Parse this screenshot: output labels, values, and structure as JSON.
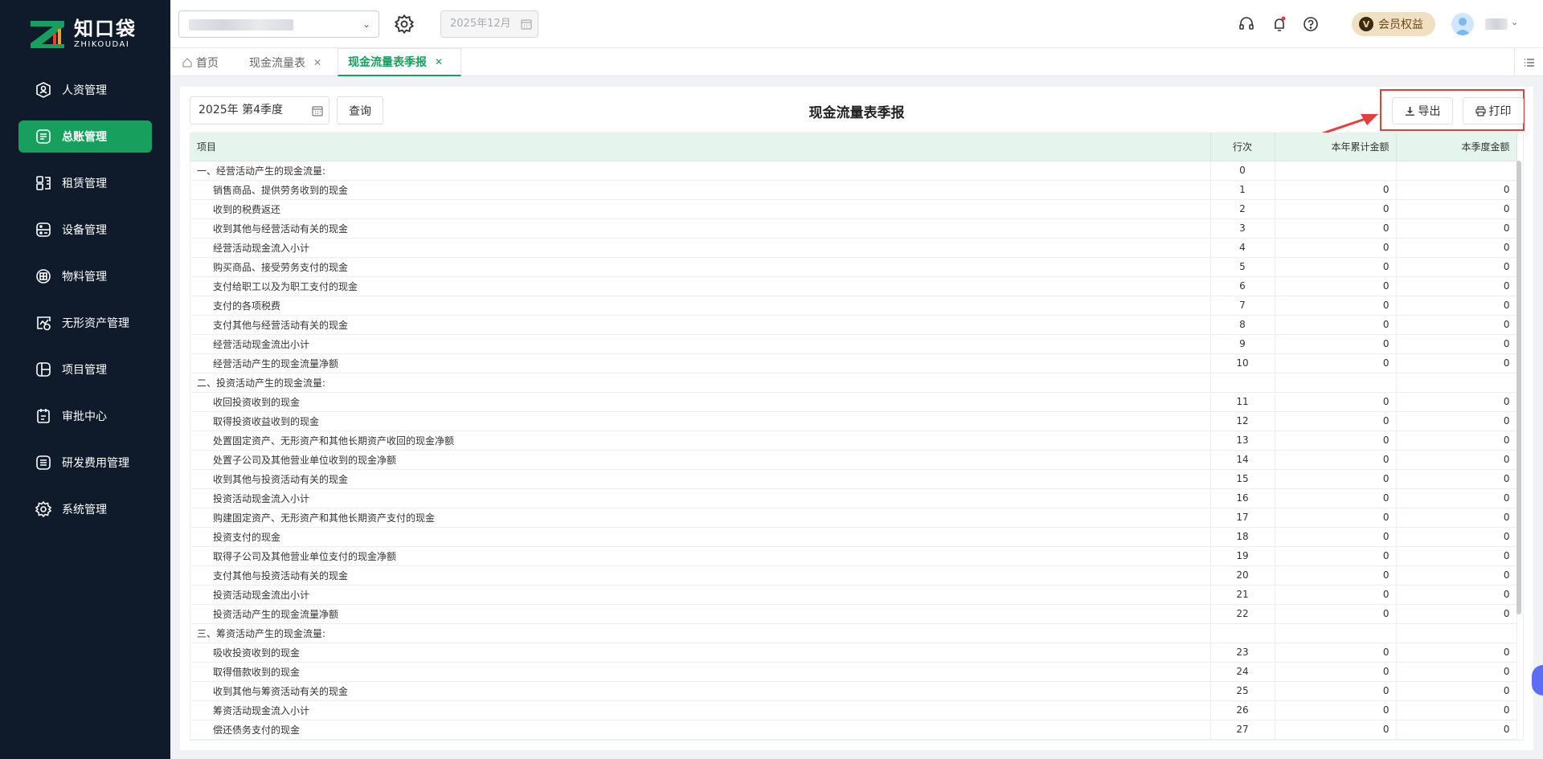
{
  "brand": {
    "name_cn": "知口袋",
    "name_en": "ZHIKOUDAI"
  },
  "sidebar": {
    "items": [
      {
        "label": "人资管理",
        "icon": "person-icon",
        "active": false
      },
      {
        "label": "总账管理",
        "icon": "ledger-icon",
        "active": true
      },
      {
        "label": "租赁管理",
        "icon": "lease-icon",
        "active": false
      },
      {
        "label": "设备管理",
        "icon": "device-icon",
        "active": false
      },
      {
        "label": "物料管理",
        "icon": "material-icon",
        "active": false
      },
      {
        "label": "无形资产管理",
        "icon": "intangible-asset-icon",
        "active": false
      },
      {
        "label": "项目管理",
        "icon": "project-icon",
        "active": false
      },
      {
        "label": "审批中心",
        "icon": "approval-icon",
        "active": false
      },
      {
        "label": "研发费用管理",
        "icon": "rd-expense-icon",
        "active": false
      },
      {
        "label": "系统管理",
        "icon": "gear-icon",
        "active": false
      }
    ]
  },
  "header": {
    "period": "2025年12月",
    "vip_label": "会员权益",
    "vip_badge": "V"
  },
  "tabs": [
    {
      "label": "首页",
      "closable": false,
      "active": false
    },
    {
      "label": "现金流量表",
      "closable": true,
      "active": false
    },
    {
      "label": "现金流量表季报",
      "closable": true,
      "active": true
    }
  ],
  "toolbar": {
    "period_value": "2025年 第4季度",
    "query_label": "查询",
    "title": "现金流量表季报",
    "export_label": "导出",
    "print_label": "打印"
  },
  "table": {
    "headers": [
      "项目",
      "行次",
      "本年累计金额",
      "本季度金额"
    ],
    "rows": [
      {
        "item": "一、经营活动产生的现金流量:",
        "line": "0",
        "ytd": "",
        "qtr": "",
        "section": true
      },
      {
        "item": "销售商品、提供劳务收到的现金",
        "line": "1",
        "ytd": "0",
        "qtr": "0"
      },
      {
        "item": "收到的税费返还",
        "line": "2",
        "ytd": "0",
        "qtr": "0"
      },
      {
        "item": "收到其他与经营活动有关的现金",
        "line": "3",
        "ytd": "0",
        "qtr": "0"
      },
      {
        "item": "经营活动现金流入小计",
        "line": "4",
        "ytd": "0",
        "qtr": "0"
      },
      {
        "item": "购买商品、接受劳务支付的现金",
        "line": "5",
        "ytd": "0",
        "qtr": "0"
      },
      {
        "item": "支付给职工以及为职工支付的现金",
        "line": "6",
        "ytd": "0",
        "qtr": "0"
      },
      {
        "item": "支付的各项税费",
        "line": "7",
        "ytd": "0",
        "qtr": "0"
      },
      {
        "item": "支付其他与经营活动有关的现金",
        "line": "8",
        "ytd": "0",
        "qtr": "0"
      },
      {
        "item": "经营活动现金流出小计",
        "line": "9",
        "ytd": "0",
        "qtr": "0"
      },
      {
        "item": "经营活动产生的现金流量净额",
        "line": "10",
        "ytd": "0",
        "qtr": "0"
      },
      {
        "item": "二、投资活动产生的现金流量:",
        "line": "",
        "ytd": "",
        "qtr": "",
        "section": true
      },
      {
        "item": "收回投资收到的现金",
        "line": "11",
        "ytd": "0",
        "qtr": "0"
      },
      {
        "item": "取得投资收益收到的现金",
        "line": "12",
        "ytd": "0",
        "qtr": "0"
      },
      {
        "item": "处置固定资产、无形资产和其他长期资产收回的现金净额",
        "line": "13",
        "ytd": "0",
        "qtr": "0"
      },
      {
        "item": "处置子公司及其他营业单位收到的现金净额",
        "line": "14",
        "ytd": "0",
        "qtr": "0"
      },
      {
        "item": "收到其他与投资活动有关的现金",
        "line": "15",
        "ytd": "0",
        "qtr": "0"
      },
      {
        "item": "投资活动现金流入小计",
        "line": "16",
        "ytd": "0",
        "qtr": "0"
      },
      {
        "item": "购建固定资产、无形资产和其他长期资产支付的现金",
        "line": "17",
        "ytd": "0",
        "qtr": "0"
      },
      {
        "item": "投资支付的现金",
        "line": "18",
        "ytd": "0",
        "qtr": "0"
      },
      {
        "item": "取得子公司及其他营业单位支付的现金净额",
        "line": "19",
        "ytd": "0",
        "qtr": "0"
      },
      {
        "item": "支付其他与投资活动有关的现金",
        "line": "20",
        "ytd": "0",
        "qtr": "0"
      },
      {
        "item": "投资活动现金流出小计",
        "line": "21",
        "ytd": "0",
        "qtr": "0"
      },
      {
        "item": "投资活动产生的现金流量净额",
        "line": "22",
        "ytd": "0",
        "qtr": "0"
      },
      {
        "item": "三、筹资活动产生的现金流量:",
        "line": "",
        "ytd": "",
        "qtr": "",
        "section": true
      },
      {
        "item": "吸收投资收到的现金",
        "line": "23",
        "ytd": "0",
        "qtr": "0"
      },
      {
        "item": "取得借款收到的现金",
        "line": "24",
        "ytd": "0",
        "qtr": "0"
      },
      {
        "item": "收到其他与筹资活动有关的现金",
        "line": "25",
        "ytd": "0",
        "qtr": "0"
      },
      {
        "item": "筹资活动现金流入小计",
        "line": "26",
        "ytd": "0",
        "qtr": "0"
      },
      {
        "item": "偿还债务支付的现金",
        "line": "27",
        "ytd": "0",
        "qtr": "0"
      }
    ]
  },
  "colors": {
    "accent": "#17a05d",
    "sidebar_bg": "#0f1a2b",
    "highlight": "#e53e3e",
    "header_row": "#e6f4ee"
  }
}
